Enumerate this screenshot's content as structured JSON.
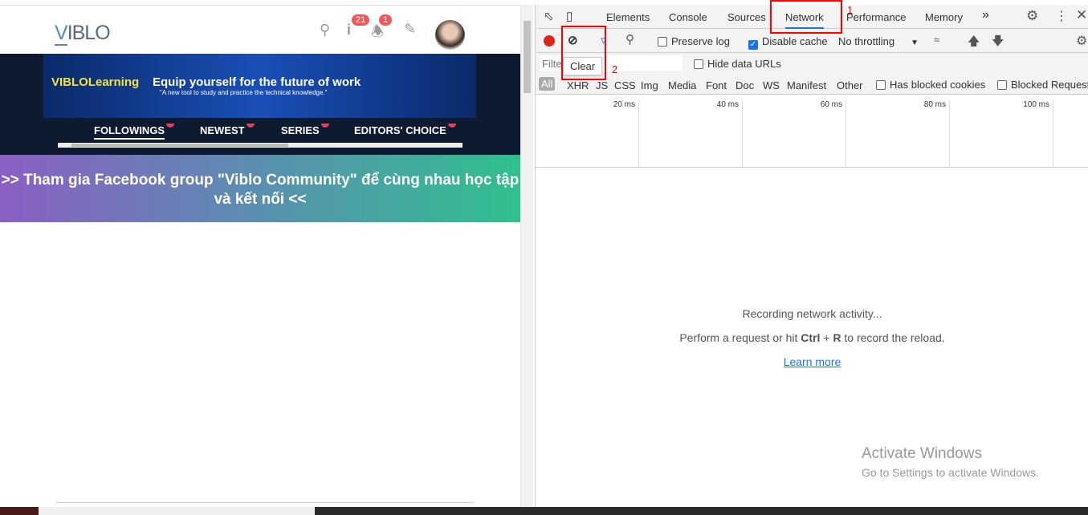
{
  "site": {
    "logo": "VIBLO",
    "badges": {
      "info": "21",
      "notifications": "1"
    },
    "banner": {
      "brand": "VIBLOLearning",
      "title": "Equip yourself for the future of work",
      "subtitle": "\"A new tool to study and practice the technical knowledge.\""
    },
    "tabs": [
      "FOLLOWINGS",
      "NEWEST",
      "SERIES",
      "EDITORS' CHOICE"
    ],
    "promo": ">> Tham gia Facebook group \"Viblo Community\" để cùng nhau học tập và kết nối <<"
  },
  "devtools": {
    "tabs": [
      "Elements",
      "Console",
      "Sources",
      "Network",
      "Performance",
      "Memory"
    ],
    "active_tab": "Network",
    "more": "»",
    "preserve_log": "Preserve log",
    "disable_cache": "Disable cache",
    "throttling": "No throttling",
    "filter_placeholder": "Filter",
    "tooltip": "Clear",
    "hide_data_urls": "Hide data URLs",
    "types": [
      "All",
      "XHR",
      "JS",
      "CSS",
      "Img",
      "Media",
      "Font",
      "Doc",
      "WS",
      "Manifest",
      "Other"
    ],
    "has_blocked": "Has blocked cookies",
    "blocked_requests": "Blocked Requests",
    "ticks": [
      "20 ms",
      "40 ms",
      "60 ms",
      "80 ms",
      "100 ms"
    ],
    "recording": "Recording network activity...",
    "hint_pre": "Perform a request or hit ",
    "hint_key1": "Ctrl",
    "hint_plus": " + ",
    "hint_key2": "R",
    "hint_post": " to record the reload.",
    "learn_more": "Learn more"
  },
  "annotations": {
    "a1": "1",
    "a2": "2"
  },
  "watermark": {
    "title": "Activate Windows",
    "sub": "Go to Settings to activate Windows."
  }
}
